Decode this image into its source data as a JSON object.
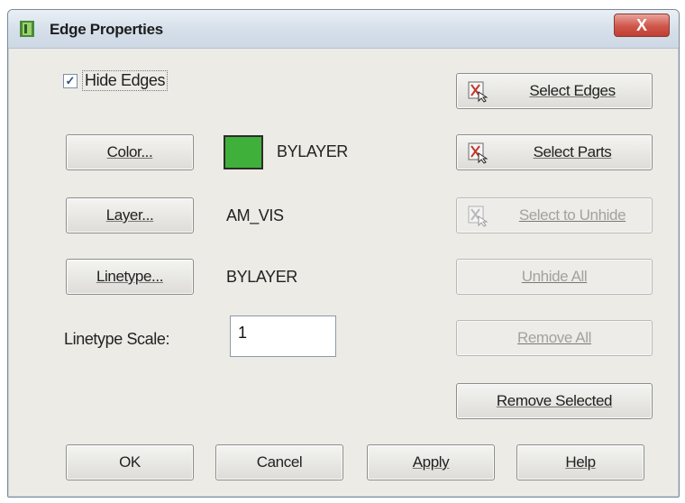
{
  "window": {
    "title": "Edge Properties",
    "close_label": "X"
  },
  "options": {
    "hide_edges_label": "Hide Edges",
    "hide_edges_checked": true,
    "checkmark": "✓"
  },
  "properties": {
    "color_button": "Color...",
    "color_value": "BYLAYER",
    "color_swatch": "#3fb13a",
    "layer_button": "Layer...",
    "layer_value": "AM_VIS",
    "linetype_button": "Linetype...",
    "linetype_value": "BYLAYER",
    "linetype_scale_label": "Linetype Scale:",
    "linetype_scale_value": "1"
  },
  "selection": {
    "select_edges": "Select Edges",
    "select_parts": "Select Parts",
    "select_to_unhide": "Select to Unhide",
    "unhide_all": "Unhide All",
    "remove_all": "Remove All",
    "remove_selected": "Remove Selected"
  },
  "footer": {
    "ok": "OK",
    "cancel": "Cancel",
    "apply": "Apply",
    "help": "Help"
  },
  "icons": {
    "app": "app-icon",
    "select": "select-cursor-icon"
  }
}
